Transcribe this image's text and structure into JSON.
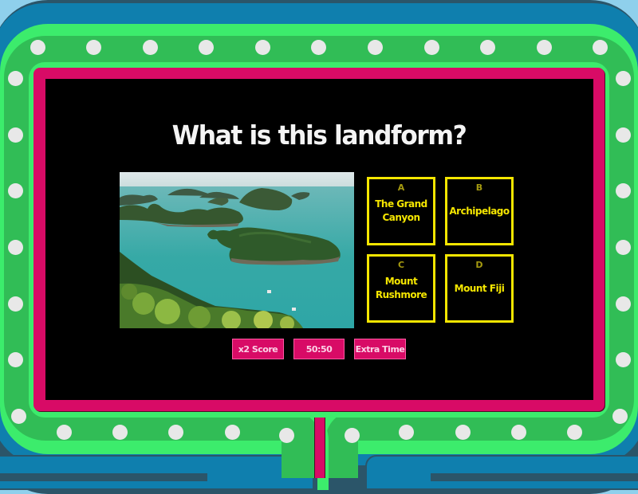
{
  "question": {
    "title": "What is this landform?",
    "image": {
      "description": "aerial view of a tropical archipelago with forested islands in turquoise sea",
      "icon": "island-photo"
    }
  },
  "answers": [
    {
      "letter": "A",
      "label": "The Grand Canyon"
    },
    {
      "letter": "B",
      "label": "Archipelago"
    },
    {
      "letter": "C",
      "label": "Mount Rushmore"
    },
    {
      "letter": "D",
      "label": "Mount Fiji"
    }
  ],
  "powerups": [
    {
      "label": "x2 Score"
    },
    {
      "label": "50:50"
    },
    {
      "label": "Extra Time"
    }
  ],
  "colors": {
    "frame_green_light": "#3cec6c",
    "frame_green_dark": "#31bd56",
    "frame_pink": "#d80b66",
    "frame_blue": "#0f7fae",
    "screen_bg": "#000000",
    "answer_yellow": "#f5e600",
    "bulb": "#e8e8e8"
  }
}
